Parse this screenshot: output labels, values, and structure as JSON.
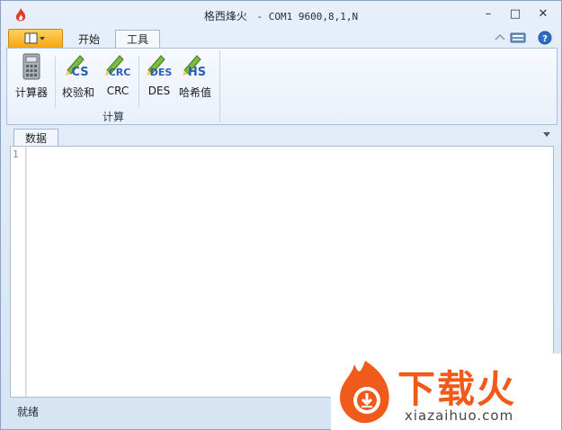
{
  "window": {
    "title": "格西烽火",
    "subtitle": " - COM1  9600,8,1,N"
  },
  "window_controls": {
    "minimize": "–",
    "maximize": "□",
    "close": "✕"
  },
  "ribbon": {
    "tabs": [
      {
        "label": "开始"
      },
      {
        "label": "工具"
      }
    ],
    "buttons": [
      {
        "label": "计算器",
        "icon": "calculator-icon"
      },
      {
        "label": "校验和",
        "icon_text": "CS"
      },
      {
        "label": "CRC",
        "icon_text": "CRC"
      },
      {
        "label": "DES",
        "icon_text": "DES"
      },
      {
        "label": "哈希值",
        "icon_text": "HS"
      }
    ],
    "group_label": "计算"
  },
  "document": {
    "tab": "数据",
    "line_number": "1"
  },
  "status": {
    "text": "就绪"
  },
  "watermark": {
    "text": "下载火",
    "url": "xiazaihuo.com"
  },
  "colors": {
    "accent": "#f5a30f",
    "brand": "#f05a1a"
  }
}
